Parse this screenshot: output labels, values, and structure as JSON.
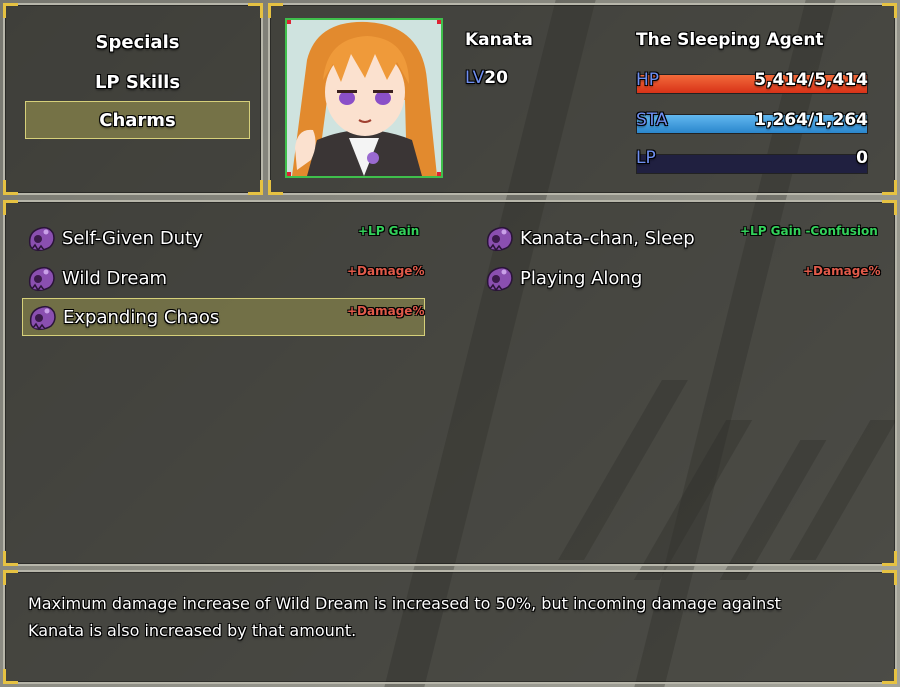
{
  "menu": {
    "items": [
      {
        "label": "Specials"
      },
      {
        "label": "LP Skills"
      },
      {
        "label": "Charms"
      }
    ],
    "selected": "Charms"
  },
  "character": {
    "name": "Kanata",
    "title": "The Sleeping Agent",
    "level_prefix": "LV",
    "level": "20",
    "stats": {
      "hp": {
        "label": "HP",
        "value": "5,414/5,414",
        "fraction": 1.0,
        "color": "#e8452a"
      },
      "sta": {
        "label": "STA",
        "value": "1,264/1,264",
        "fraction": 1.0,
        "color": "#3a9ee0"
      },
      "lp": {
        "label": "LP",
        "value": "0",
        "fraction": 0.0,
        "color": "#5a5ad0"
      }
    }
  },
  "charms": [
    {
      "name": "Self-Given Duty",
      "tag": "+LP Gain",
      "tag_color": "green",
      "icon": "purple-blob-icon"
    },
    {
      "name": "Kanata-chan, Sleep",
      "tag": "+LP Gain -Confusion",
      "tag_color": "green",
      "icon": "purple-blob-icon"
    },
    {
      "name": "Wild Dream",
      "tag": "+Damage%",
      "tag_color": "red",
      "icon": "purple-blob-icon"
    },
    {
      "name": "Playing Along",
      "tag": "+Damage%",
      "tag_color": "red",
      "icon": "purple-blob-icon"
    },
    {
      "name": "Expanding Chaos",
      "tag": "+Damage%",
      "tag_color": "red",
      "icon": "purple-blob-icon",
      "selected": true
    }
  ],
  "description": {
    "line1": "Maximum damage increase of Wild Dream is increased to 50%, but incoming damage against",
    "line2": "Kanata is also increased by that amount."
  },
  "colors": {
    "accent_gold": "#e6c242",
    "selection": "#a09b50",
    "tag_green": "#33d15a",
    "tag_red": "#e05a4a",
    "charm_purple": "#8a4fb0"
  }
}
